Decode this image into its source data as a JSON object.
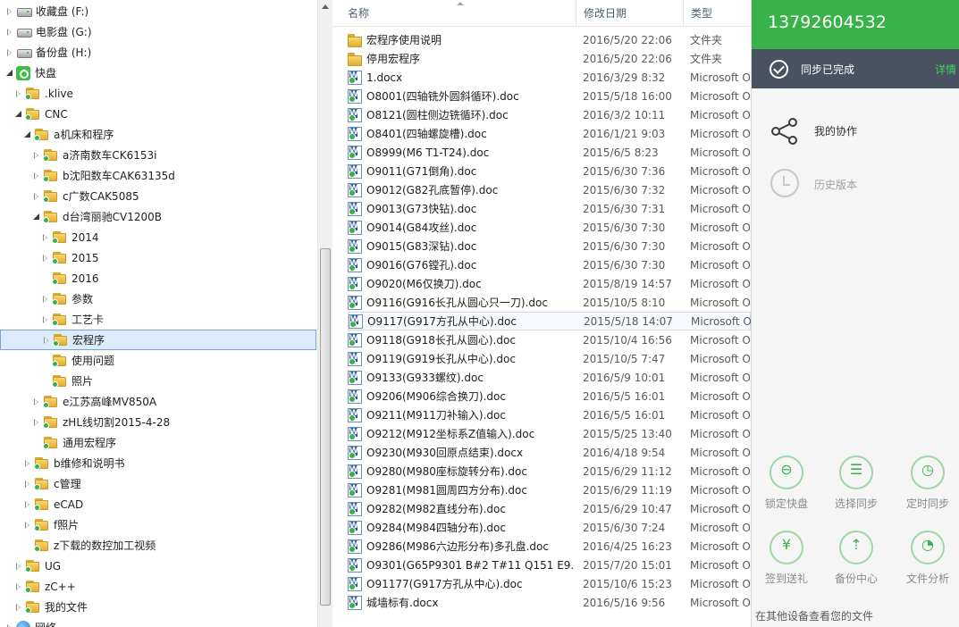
{
  "tree": {
    "items": [
      {
        "label": "收藏盘 (F:)",
        "icon": "drive-icon",
        "arrow": "collapsed",
        "indent": 0
      },
      {
        "label": "电影盘 (G:)",
        "icon": "drive-icon",
        "arrow": "collapsed",
        "indent": 0
      },
      {
        "label": "备份盘 (H:)",
        "icon": "drive-icon",
        "arrow": "collapsed",
        "indent": 0
      },
      {
        "label": "快盘",
        "icon": "app-icon",
        "arrow": "expanded",
        "indent": 0
      },
      {
        "label": ".klive",
        "icon": "folder-sync-icon",
        "arrow": "collapsed",
        "indent": 1
      },
      {
        "label": "CNC",
        "icon": "folder-sync-icon",
        "arrow": "expanded",
        "indent": 1
      },
      {
        "label": "a机床和程序",
        "icon": "folder-sync-icon",
        "arrow": "expanded",
        "indent": 2
      },
      {
        "label": "a济南数车CK6153i",
        "icon": "folder-sync-icon",
        "arrow": "collapsed",
        "indent": 3
      },
      {
        "label": "b沈阳数车CAK63135d",
        "icon": "folder-sync-icon",
        "arrow": "collapsed",
        "indent": 3
      },
      {
        "label": "c广数CAK5085",
        "icon": "folder-sync-icon",
        "arrow": "collapsed",
        "indent": 3
      },
      {
        "label": "d台湾丽驰CV1200B",
        "icon": "folder-sync-icon",
        "arrow": "expanded",
        "indent": 3
      },
      {
        "label": "2014",
        "icon": "folder-sync-icon",
        "arrow": "collapsed",
        "indent": 4
      },
      {
        "label": "2015",
        "icon": "folder-sync-icon",
        "arrow": "collapsed",
        "indent": 4
      },
      {
        "label": "2016",
        "icon": "folder-sync-icon",
        "arrow": "none",
        "indent": 4
      },
      {
        "label": "参数",
        "icon": "folder-sync-icon",
        "arrow": "collapsed",
        "indent": 4
      },
      {
        "label": "工艺卡",
        "icon": "folder-sync-icon",
        "arrow": "collapsed",
        "indent": 4
      },
      {
        "label": "宏程序",
        "icon": "folder-sync-icon",
        "arrow": "collapsed",
        "indent": 4,
        "selected": true
      },
      {
        "label": "使用问题",
        "icon": "folder-sync-icon",
        "arrow": "none",
        "indent": 4
      },
      {
        "label": "照片",
        "icon": "folder-sync-icon",
        "arrow": "none",
        "indent": 4
      },
      {
        "label": "e江苏高峰MV850A",
        "icon": "folder-sync-icon",
        "arrow": "collapsed",
        "indent": 3
      },
      {
        "label": "zHL线切割2015-4-28",
        "icon": "folder-sync-icon",
        "arrow": "collapsed",
        "indent": 3
      },
      {
        "label": "通用宏程序",
        "icon": "folder-sync-icon",
        "arrow": "none",
        "indent": 3
      },
      {
        "label": "b维修和说明书",
        "icon": "folder-sync-icon",
        "arrow": "collapsed",
        "indent": 2
      },
      {
        "label": "c管理",
        "icon": "folder-sync-icon",
        "arrow": "collapsed",
        "indent": 2
      },
      {
        "label": "eCAD",
        "icon": "folder-sync-icon",
        "arrow": "collapsed",
        "indent": 2
      },
      {
        "label": "f照片",
        "icon": "folder-sync-icon",
        "arrow": "collapsed",
        "indent": 2
      },
      {
        "label": "z下载的数控加工视频",
        "icon": "folder-sync-icon",
        "arrow": "none",
        "indent": 2
      },
      {
        "label": "UG",
        "icon": "folder-sync-icon",
        "arrow": "collapsed",
        "indent": 1
      },
      {
        "label": "zC++",
        "icon": "folder-sync-icon",
        "arrow": "collapsed",
        "indent": 1
      },
      {
        "label": "我的文件",
        "icon": "folder-sync-icon",
        "arrow": "collapsed",
        "indent": 1
      },
      {
        "label": "网络",
        "icon": "network-icon",
        "arrow": "collapsed",
        "indent": 0
      }
    ]
  },
  "filelist": {
    "columns": {
      "name": "名称",
      "date": "修改日期",
      "type": "类型"
    },
    "rows": [
      {
        "name": "宏程序使用说明",
        "date": "2016/5/20 22:06",
        "type": "文件夹",
        "kind": "folder"
      },
      {
        "name": "停用宏程序",
        "date": "2016/5/20 22:06",
        "type": "文件夹",
        "kind": "folder"
      },
      {
        "name": "1.docx",
        "date": "2016/3/29 8:32",
        "type": "Microsoft Office",
        "kind": "doc"
      },
      {
        "name": "O8001(四轴铣外圆斜循环).doc",
        "date": "2015/5/18 16:00",
        "type": "Microsoft Office",
        "kind": "doc"
      },
      {
        "name": "O8121(圆柱侧边铣循环).doc",
        "date": "2016/3/2 10:11",
        "type": "Microsoft Office",
        "kind": "doc"
      },
      {
        "name": "O8401(四轴螺旋槽).doc",
        "date": "2016/1/21 9:03",
        "type": "Microsoft Office",
        "kind": "doc"
      },
      {
        "name": "O8999(M6 T1-T24).doc",
        "date": "2015/6/5 8:23",
        "type": "Microsoft Office",
        "kind": "doc"
      },
      {
        "name": "O9011(G71倒角).doc",
        "date": "2015/6/30 7:36",
        "type": "Microsoft Office",
        "kind": "doc"
      },
      {
        "name": "O9012(G82孔底暂停).doc",
        "date": "2015/6/30 7:32",
        "type": "Microsoft Office",
        "kind": "doc"
      },
      {
        "name": "O9013(G73快钻).doc",
        "date": "2015/6/30 7:31",
        "type": "Microsoft Office",
        "kind": "doc"
      },
      {
        "name": "O9014(G84攻丝).doc",
        "date": "2015/6/30 7:30",
        "type": "Microsoft Office",
        "kind": "doc"
      },
      {
        "name": "O9015(G83深钻).doc",
        "date": "2015/6/30 7:30",
        "type": "Microsoft Office",
        "kind": "doc"
      },
      {
        "name": "O9016(G76镗孔).doc",
        "date": "2015/6/30 7:30",
        "type": "Microsoft Office",
        "kind": "doc"
      },
      {
        "name": "O9020(M6仅换刀).doc",
        "date": "2015/8/19 14:57",
        "type": "Microsoft Office",
        "kind": "doc"
      },
      {
        "name": "O9116(G916长孔从圆心只一刀).doc",
        "date": "2015/10/5 8:10",
        "type": "Microsoft Office",
        "kind": "doc"
      },
      {
        "name": "O9117(G917方孔从中心).doc",
        "date": "2015/5/18 14:07",
        "type": "Microsoft Office",
        "kind": "doc",
        "hovered": true
      },
      {
        "name": "O9118(G918长孔从圆心).doc",
        "date": "2015/10/4 16:56",
        "type": "Microsoft Office",
        "kind": "doc"
      },
      {
        "name": "O9119(G919长孔从中心).doc",
        "date": "2015/10/5 7:47",
        "type": "Microsoft Office",
        "kind": "doc"
      },
      {
        "name": "O9133(G933螺纹).doc",
        "date": "2016/5/9 10:01",
        "type": "Microsoft Office",
        "kind": "doc"
      },
      {
        "name": "O9206(M906综合换刀).doc",
        "date": "2016/5/5 16:01",
        "type": "Microsoft Office",
        "kind": "doc"
      },
      {
        "name": "O9211(M911刀补输入).doc",
        "date": "2016/5/5 16:01",
        "type": "Microsoft Office",
        "kind": "doc"
      },
      {
        "name": "O9212(M912坐标系Z值输入).doc",
        "date": "2015/5/25 13:40",
        "type": "Microsoft Office",
        "kind": "doc"
      },
      {
        "name": "O9230(M930回原点结束).docx",
        "date": "2016/4/18 9:54",
        "type": "Microsoft Office",
        "kind": "doc"
      },
      {
        "name": "O9280(M980座标旋转分布).doc",
        "date": "2015/6/29 11:12",
        "type": "Microsoft Office",
        "kind": "doc"
      },
      {
        "name": "O9281(M981圆周四方分布).doc",
        "date": "2015/6/29 11:19",
        "type": "Microsoft Office",
        "kind": "doc"
      },
      {
        "name": "O9282(M982直线分布).doc",
        "date": "2015/6/29 10:47",
        "type": "Microsoft Office",
        "kind": "doc"
      },
      {
        "name": "O9284(M984四轴分布).doc",
        "date": "2015/6/30 7:24",
        "type": "Microsoft Office",
        "kind": "doc"
      },
      {
        "name": "O9286(M986六边形分布)多孔盘.doc",
        "date": "2016/4/25 16:23",
        "type": "Microsoft Office",
        "kind": "doc"
      },
      {
        "name": "O9301(G65P9301 B#2 T#11 Q151 E9...",
        "date": "2015/7/20 15:01",
        "type": "Microsoft Office",
        "kind": "doc"
      },
      {
        "name": "O91177(G917方孔从中心).doc",
        "date": "2015/10/6 15:23",
        "type": "Microsoft Office",
        "kind": "doc"
      },
      {
        "name": "城墙标有.docx",
        "date": "2016/5/16 9:56",
        "type": "Microsoft Office",
        "kind": "doc"
      }
    ]
  },
  "panel": {
    "phone": "13792604532",
    "sync_status": "同步已完成",
    "sync_detail": "详情",
    "collab_label": "我的协作",
    "history_label": "历史版本",
    "tools": [
      {
        "label": "锁定快盘",
        "icon": "lock-icon",
        "glyph": "⊖"
      },
      {
        "label": "选择同步",
        "icon": "checklist-icon",
        "glyph": "☰"
      },
      {
        "label": "定时同步",
        "icon": "alarm-clock-icon",
        "glyph": "◷"
      },
      {
        "label": "签到送礼",
        "icon": "yen-gift-icon",
        "glyph": "¥"
      },
      {
        "label": "备份中心",
        "icon": "upload-backup-icon",
        "glyph": "⇡"
      },
      {
        "label": "文件分析",
        "icon": "pie-chart-icon",
        "glyph": "◔"
      }
    ],
    "footer": "在其他设备查看您的文件",
    "accent": "#39b24a",
    "dark": "#4a5262"
  }
}
